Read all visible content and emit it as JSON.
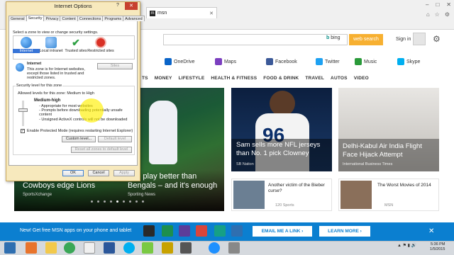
{
  "browser": {
    "tab_label": "msn",
    "tab_favicon": "msn-icon",
    "window_controls": [
      "–",
      "□",
      "✕"
    ],
    "toolbar_icons": [
      "home-icon",
      "star-icon",
      "gear-icon"
    ]
  },
  "msn": {
    "search_engine": "bing",
    "search_button": "web search",
    "sign_in": "Sign in",
    "services": [
      {
        "label": "OneDrive",
        "icon": "onedrive-icon",
        "color": "#0a64c8"
      },
      {
        "label": "Maps",
        "icon": "maps-icon",
        "color": "#7b3fbf"
      },
      {
        "label": "Facebook",
        "icon": "facebook-icon",
        "color": "#3b5998"
      },
      {
        "label": "Twitter",
        "icon": "twitter-icon",
        "color": "#1da1f2"
      },
      {
        "label": "Music",
        "icon": "music-icon",
        "color": "#2a9a3a"
      },
      {
        "label": "Skype",
        "icon": "skype-icon",
        "color": "#00aff0"
      }
    ],
    "nav_categories": [
      "TS",
      "MONEY",
      "LIFESTYLE",
      "HEALTH & FITNESS",
      "FOOD & DRINK",
      "TRAVEL",
      "AUTOS",
      "VIDEO"
    ],
    "hero": {
      "left_title": "Cowboys edge Lions",
      "left_source": "SportsXchange",
      "title_line1": "one play better than",
      "title_line2": "Bengals – and it's enough",
      "source": "Sporting News"
    },
    "card2": {
      "title_line1": "Sam sells more NFL jerseys",
      "title_line2": "than No. 1 pick Clowney",
      "source": "SB Nation"
    },
    "card3": {
      "title_line1": "Delhi-Kabul Air India Flight",
      "title_line2": "Face Hijack Attempt",
      "source": "International Business Times"
    },
    "small_cards": [
      {
        "title": "Another victim of the Bieber curse?",
        "source": "120 Sports"
      },
      {
        "title": "The Worst Movies of 2014",
        "source": "MSN"
      }
    ],
    "banner": {
      "text": "New! Get free MSN apps on your phone and tablet",
      "email_button": "EMAIL ME A LINK ›",
      "learn_button": "LEARN MORE ›",
      "close": "✕",
      "app_icons": [
        {
          "name": "news-app-icon",
          "color": "#2a2a2a"
        },
        {
          "name": "money-app-icon",
          "color": "#1d8f4e"
        },
        {
          "name": "sports-app-icon",
          "color": "#5c3d99"
        },
        {
          "name": "health-app-icon",
          "color": "#d9453b"
        },
        {
          "name": "food-app-icon",
          "color": "#16a085"
        },
        {
          "name": "weather-app-icon",
          "color": "#2f6fb0"
        }
      ]
    }
  },
  "dialog": {
    "title": "Internet Options",
    "help": "?",
    "close": "✕",
    "tabs": [
      "General",
      "Security",
      "Privacy",
      "Content",
      "Connections",
      "Programs",
      "Advanced"
    ],
    "active_tab": "Security",
    "zone_prompt": "Select a zone to view or change security settings.",
    "zones": [
      {
        "label": "Internet",
        "icon": "globe-icon",
        "color": "#1d6fc9",
        "selected": true
      },
      {
        "label": "Local intranet",
        "icon": "intranet-icon",
        "color": "#3b8bd6",
        "selected": false
      },
      {
        "label": "Trusted sites",
        "icon": "checkmark-icon",
        "color": "#2ea043",
        "selected": false
      },
      {
        "label": "Restricted sites",
        "icon": "restricted-icon",
        "color": "#d93025",
        "selected": false
      }
    ],
    "zone_name": "Internet",
    "zone_desc_1": "This zone is for Internet websites,",
    "zone_desc_2": "except those listed in trusted and",
    "zone_desc_3": "restricted zones.",
    "sites_button": "Sites",
    "security_level_title": "Security level for this zone",
    "allowed_levels": "Allowed levels for this zone: Medium to High",
    "level_name": "Medium-high",
    "level_desc": [
      "- Appropriate for most websites",
      "- Prompts before downloading potentially unsafe",
      "  content",
      "- Unsigned ActiveX controls will not be downloaded"
    ],
    "protected_mode": "Enable Protected Mode (requires restarting Internet Explorer)",
    "custom_level": "Custom level...",
    "default_level": "Default level",
    "reset_all": "Reset all zones to default level",
    "ok": "OK",
    "cancel": "Cancel",
    "apply": "Apply"
  },
  "taskbar": {
    "apps": [
      {
        "name": "start-icon",
        "color": "#2f6fb0"
      },
      {
        "name": "media-player-icon",
        "color": "#e8742c"
      },
      {
        "name": "folder-icon",
        "color": "#f2c94c"
      },
      {
        "name": "chrome-icon",
        "color": "#3aa757"
      },
      {
        "name": "q-app-icon",
        "color": "#f0f0f0"
      },
      {
        "name": "word-icon",
        "color": "#2b579a"
      },
      {
        "name": "skype-taskbar-icon",
        "color": "#00aff0"
      },
      {
        "name": "paint-icon",
        "color": "#7ac943"
      },
      {
        "name": "winamp-icon",
        "color": "#c8a200"
      },
      {
        "name": "monitor-icon",
        "color": "#555555"
      },
      {
        "name": "ie-icon",
        "color": "#1e90ff"
      },
      {
        "name": "photo-icon",
        "color": "#888888"
      }
    ],
    "time": "5:36 PM",
    "date": "1/5/2015"
  }
}
